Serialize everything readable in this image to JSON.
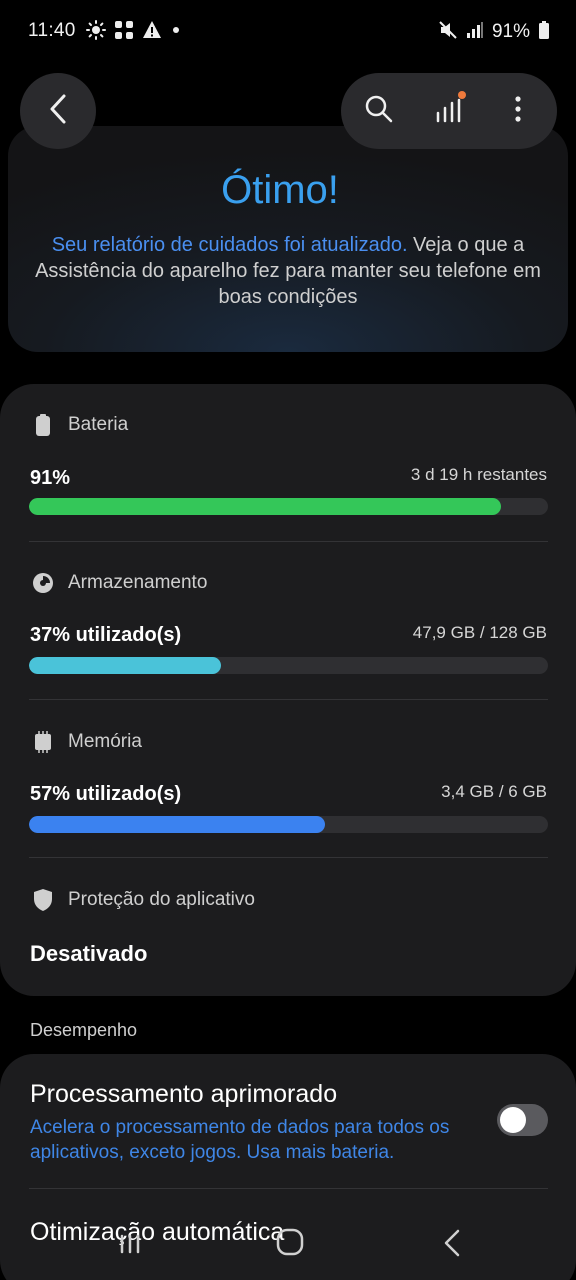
{
  "status_bar": {
    "time": "11:40",
    "battery_text": "91%",
    "icons_left": [
      "sun-icon",
      "grid-icon",
      "warning-icon",
      "dot-icon"
    ],
    "icons_right": [
      "mute-icon",
      "signal-icon",
      "battery-icon"
    ]
  },
  "top_bar": {
    "back_icon": "back-arrow-icon",
    "actions": [
      "search-icon",
      "signal-bars-icon",
      "more-vertical-icon"
    ]
  },
  "header": {
    "title": "Ótimo!",
    "desc_link": "Seu relatório de cuidados foi atualizado.",
    "desc_rest": " Veja o que a Assistência do aparelho fez para manter seu telefone em boas condições"
  },
  "sections": {
    "battery": {
      "title": "Bateria",
      "value": "91%",
      "right": "3 d 19 h restantes",
      "level": 0.91,
      "color": "#34c759"
    },
    "storage": {
      "title": "Armazenamento",
      "value": "37% utilizado(s)",
      "right": "47,9 GB / 128 GB",
      "level": 0.37,
      "color": "#4ac3d9"
    },
    "memory": {
      "title": "Memória",
      "value": "57% utilizado(s)",
      "right": "3,4 GB / 6 GB",
      "level": 0.57,
      "color": "#3b82f0"
    },
    "app_protection": {
      "title": "Proteção do aplicativo",
      "value": "Desativado"
    }
  },
  "performance": {
    "label": "Desempenho",
    "title": "Processamento aprimorado",
    "desc": "Acelera o processamento de dados para todos os aplicativos, exceto jogos. Usa mais bateria.",
    "toggle_on": false,
    "next_item": "Otimização automática"
  },
  "nav_bar": [
    "recent-apps-icon",
    "home-icon",
    "back-icon"
  ]
}
